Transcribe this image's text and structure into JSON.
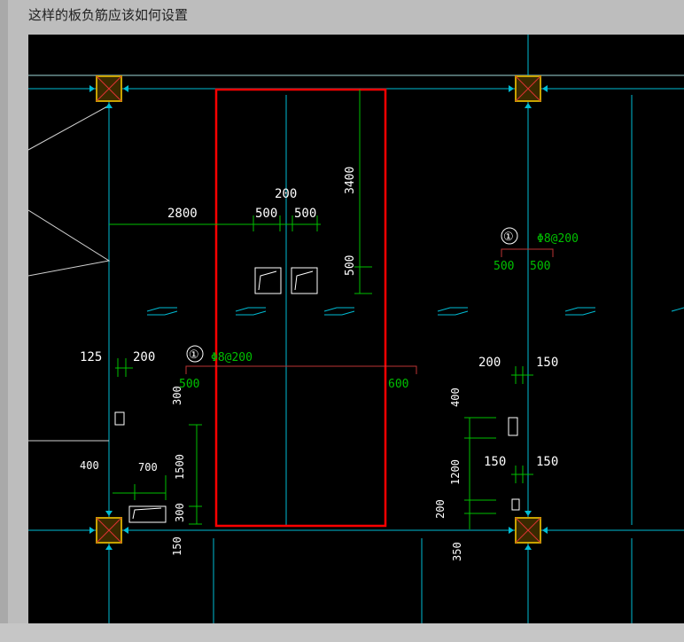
{
  "question": {
    "text": "这样的板负筋应该如何设置"
  },
  "drawing": {
    "dimensions": {
      "d2800": "2800",
      "d200_top": "200",
      "d500_left": "500",
      "d500_right": "500",
      "d3400": "3400",
      "d500_vert": "500",
      "d125": "125",
      "d200_left": "200",
      "d300": "300",
      "d1500": "1500",
      "d300_lower": "300",
      "d150_lower": "150",
      "d400": "400",
      "d700": "700",
      "d500_rebar_left": "500",
      "d600": "600",
      "r_d500_left": "500",
      "r_d500_right": "500",
      "r_d200": "200",
      "r_d150_top": "150",
      "r_d400": "400",
      "r_d150_left": "150",
      "r_d150_right": "150",
      "r_d1200": "1200",
      "r_d200_lower": "200",
      "r_d350": "350"
    },
    "rebar_mark_1": {
      "number": "①",
      "spec": "Φ8@200"
    },
    "rebar_mark_2": {
      "number": "①",
      "spec": "Φ8@200"
    }
  },
  "colors": {
    "grid": "#00bcd4",
    "dimension": "#00ff00",
    "text_white": "#ffffff",
    "highlight": "#ff0000",
    "column_fill": "#c8a200"
  }
}
